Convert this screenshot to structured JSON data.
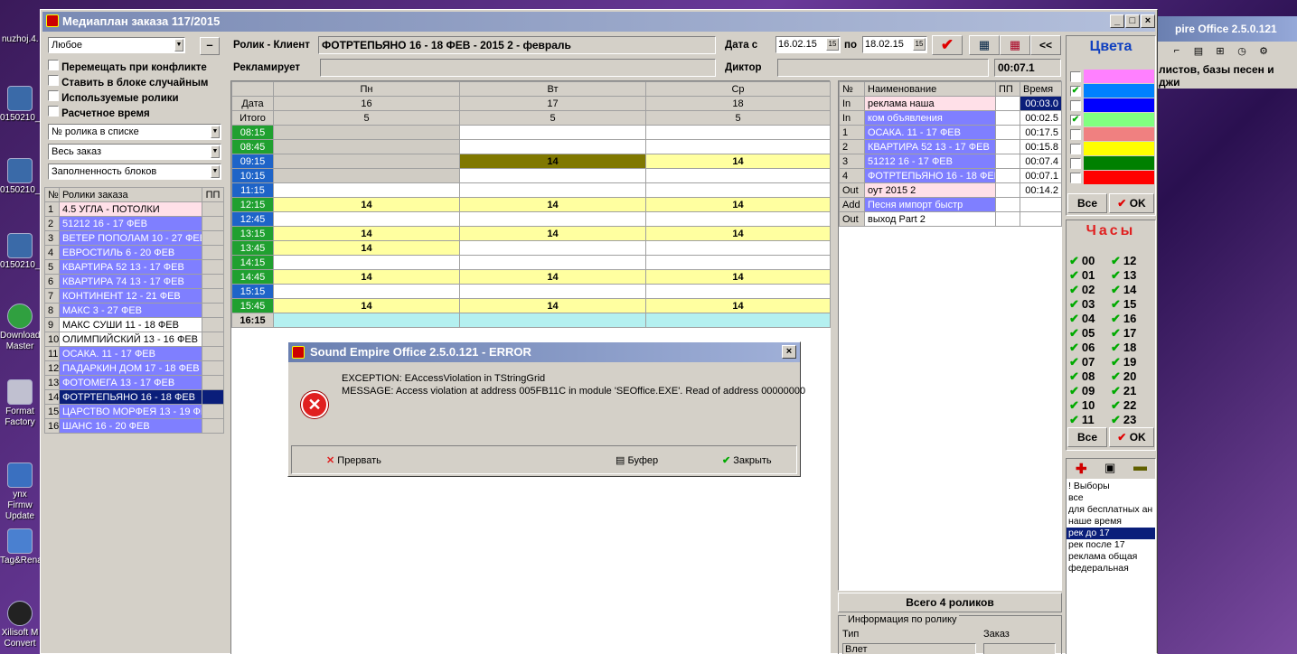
{
  "desktop": {
    "icons": [
      {
        "label": "nuzhoj.4."
      },
      {
        "label": "0150210_"
      },
      {
        "label": "0150210_"
      },
      {
        "label": "0150210_"
      },
      {
        "label": "Download Master"
      },
      {
        "label": "Format Factory"
      },
      {
        "label": "ynx Firmw Update"
      },
      {
        "label": "Tag&Rena"
      },
      {
        "label": "Xilisoft M Convert"
      }
    ]
  },
  "bgwindow": {
    "title": "pire Office 2.5.0.121",
    "text": "листов, базы песен и джи"
  },
  "window": {
    "title": "Медиаплан заказа 117/2015"
  },
  "left": {
    "filter_combo": "Любое",
    "minus_btn": "–",
    "checkboxes": [
      "Перемещать при конфликте",
      "Ставить в блоке случайным",
      "Используемые ролики",
      "Расчетное время"
    ],
    "sort_combo": "№ ролика в списке",
    "scope_combo": "Весь заказ",
    "fill_combo": "Заполненность блоков",
    "table_headers": [
      "№",
      "Ролики заказа",
      "ПП"
    ],
    "rows": [
      {
        "n": "1",
        "name": "4.5 УГЛА - ПОТОЛКИ"
      },
      {
        "n": "2",
        "name": "51212 16 - 17 ФЕВ"
      },
      {
        "n": "3",
        "name": "ВЕТЕР ПОПОЛАМ 10 - 27 ФЕВ"
      },
      {
        "n": "4",
        "name": "ЕВРОСТИЛЬ 6 - 20 ФЕВ"
      },
      {
        "n": "5",
        "name": "КВАРТИРА 52 13 - 17 ФЕВ"
      },
      {
        "n": "6",
        "name": "КВАРТИРА 74 13 - 17 ФЕВ"
      },
      {
        "n": "7",
        "name": "КОНТИНЕНТ 12 - 21 ФЕВ"
      },
      {
        "n": "8",
        "name": "МАКС 3 - 27 ФЕВ"
      },
      {
        "n": "9",
        "name": "МАКС СУШИ 11 - 18 ФЕВ"
      },
      {
        "n": "10",
        "name": "ОЛИМПИЙСКИЙ 13 - 16 ФЕВ"
      },
      {
        "n": "11",
        "name": "ОСАКА. 11 - 17 ФЕВ"
      },
      {
        "n": "12",
        "name": "ПАДАРКИН ДОМ 17 - 18 ФЕВ"
      },
      {
        "n": "13",
        "name": "ФОТОМЕГА 13 - 17 ФЕВ"
      },
      {
        "n": "14",
        "name": "ФОТРТЕПЬЯНО 16 - 18 ФЕВ"
      },
      {
        "n": "15",
        "name": "ЦАРСТВО МОРФЕЯ 13 - 19 ФЕВ"
      },
      {
        "n": "16",
        "name": "ШАНС 16 - 20 ФЕВ"
      }
    ]
  },
  "header": {
    "rolik_label": "Ролик - Клиент",
    "rolik_value": "ФОТРТЕПЬЯНО 16 - 18 ФЕВ - 2015 2 - февраль",
    "advert_label": "Рекламирует",
    "advert_value": "",
    "date_label": "Дата с",
    "date_from": "16.02.15",
    "date_to_label": "по",
    "date_to": "18.02.15",
    "cal_btn": "15",
    "speaker_label": "Диктор",
    "speaker_value": "",
    "duration": "00:07.1",
    "nav_btn": "<<"
  },
  "schedule": {
    "row_date": "Дата",
    "row_total": "Итого",
    "days": [
      {
        "name": "Пн",
        "date": "16",
        "total": "5"
      },
      {
        "name": "Вт",
        "date": "17",
        "total": "5"
      },
      {
        "name": "Ср",
        "date": "18",
        "total": "5"
      }
    ],
    "slots": [
      {
        "time": "08:15",
        "cells": [
          "",
          "",
          ""
        ]
      },
      {
        "time": "08:45",
        "cells": [
          "",
          "",
          ""
        ]
      },
      {
        "time": "09:15",
        "cells": [
          "",
          "14",
          "14"
        ]
      },
      {
        "time": "10:15",
        "cells": [
          "",
          "",
          ""
        ]
      },
      {
        "time": "11:15",
        "cells": [
          "",
          "",
          ""
        ]
      },
      {
        "time": "12:15",
        "cells": [
          "14",
          "14",
          "14"
        ]
      },
      {
        "time": "12:45",
        "cells": [
          "",
          "",
          ""
        ]
      },
      {
        "time": "13:15",
        "cells": [
          "14",
          "14",
          "14"
        ]
      },
      {
        "time": "13:45",
        "cells": [
          "14",
          "",
          ""
        ]
      },
      {
        "time": "14:15",
        "cells": [
          "",
          "",
          ""
        ]
      },
      {
        "time": "14:45",
        "cells": [
          "14",
          "14",
          "14"
        ]
      },
      {
        "time": "15:15",
        "cells": [
          "",
          "",
          ""
        ]
      },
      {
        "time": "15:45",
        "cells": [
          "14",
          "14",
          "14"
        ]
      },
      {
        "time": "16:15",
        "cells": [
          "",
          "",
          ""
        ]
      }
    ]
  },
  "block": {
    "headers": [
      "№",
      "Наименование",
      "ПП",
      "Время"
    ],
    "rows": [
      {
        "n": "In",
        "name": "реклама наша",
        "time": "00:03.0"
      },
      {
        "n": "In",
        "name": "ком объявления",
        "time": "00:02.5"
      },
      {
        "n": "1",
        "name": "ОСАКА. 11 - 17 ФЕВ",
        "time": "00:17.5"
      },
      {
        "n": "2",
        "name": "КВАРТИРА 52 13 - 17 ФЕВ",
        "time": "00:15.8"
      },
      {
        "n": "3",
        "name": "51212 16 - 17 ФЕВ",
        "time": "00:07.4"
      },
      {
        "n": "4",
        "name": "ФОТРТЕПЬЯНО 16 - 18 ФЕВ",
        "time": "00:07.1"
      },
      {
        "n": "Out",
        "name": "оут 2015 2",
        "time": "00:14.2"
      },
      {
        "n": "Add",
        "name": "Песня импорт быстр",
        "time": ""
      },
      {
        "n": "Out",
        "name": "выход Part 2",
        "time": ""
      }
    ],
    "total": "Всего 4 роликов",
    "info_title": "Информация по ролику",
    "info_type_label": "Тип",
    "info_order_label": "Заказ",
    "info_type_value": "Влет"
  },
  "colors": {
    "title": "Цвета",
    "swatches": [
      "#ff80ff",
      "#0080ff",
      "#0000ff",
      "#80ff80",
      "#f08080",
      "#ffff00",
      "#008000",
      "#ff0000"
    ],
    "checked": [
      false,
      true,
      false,
      true,
      false,
      false,
      false,
      false
    ],
    "all_btn": "Все",
    "ok_btn": "OK"
  },
  "hours": {
    "title": "Часы",
    "left": [
      "00",
      "01",
      "02",
      "03",
      "04",
      "05",
      "06",
      "07",
      "08",
      "09",
      "10",
      "11"
    ],
    "right": [
      "12",
      "13",
      "14",
      "15",
      "16",
      "17",
      "18",
      "19",
      "20",
      "21",
      "22",
      "23"
    ],
    "all_btn": "Все",
    "ok_btn": "OK"
  },
  "presets": {
    "items": [
      "! Выборы",
      "все",
      "для бесплатных ан",
      "наше время",
      "рек до 17",
      "рек после 17",
      "реклама общая",
      "федеральная"
    ],
    "selected": 4
  },
  "dialog": {
    "title": "Sound Empire Office 2.5.0.121 - ERROR",
    "exception": "EXCEPTION: EAccessViolation in TStringGrid",
    "message": "MESSAGE: Access violation at address 005FB11C in module 'SEOffice.EXE'. Read of address 00000000",
    "abort_btn": "Прервать",
    "buffer_btn": "Буфер",
    "close_btn": "Закрыть"
  }
}
